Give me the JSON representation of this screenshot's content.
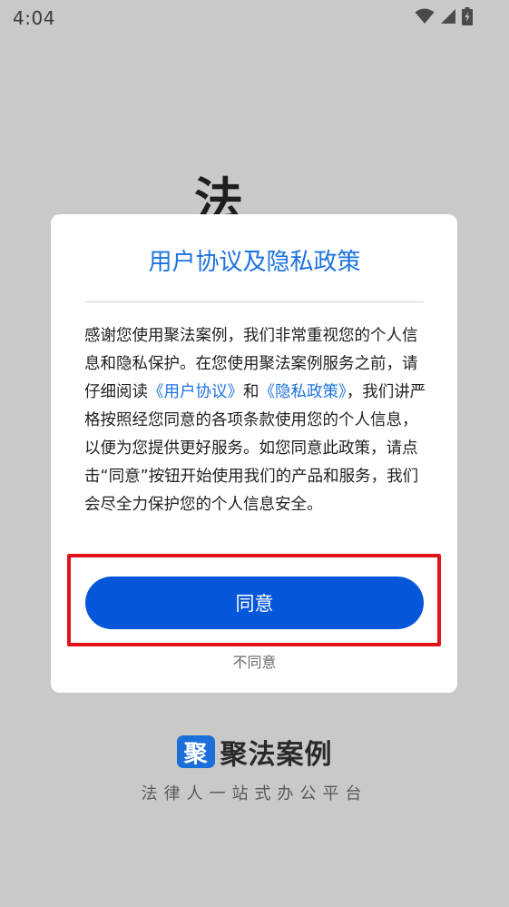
{
  "status_bar": {
    "time": "4:04",
    "icons": [
      "wifi-icon",
      "signal-icon",
      "battery-charging-icon"
    ]
  },
  "splash": {
    "partial_char": "法",
    "brand_logo_char": "聚",
    "brand_name": "聚法案例",
    "slogan": "法律人一站式办公平台"
  },
  "dialog": {
    "title": "用户协议及隐私政策",
    "body_part1": "感谢您使用聚法案例，我们非常重视您的个人信息和隐私保护。在您使用聚法案例服务之前，请仔细阅读",
    "link_user_agreement": "《用户协议》",
    "body_and": "和",
    "link_privacy_policy": "《隐私政策》",
    "body_part2": "，我们讲严格按照经您同意的各项条款使用您的个人信息，以便为您提供更好服务。如您同意此政策，请点击“同意”按钮开始使用我们的产品和服务，我们会尽全力保护您的个人信息安全。",
    "agree_label": "同意",
    "disagree_label": "不同意"
  },
  "colors": {
    "accent": "#1d73e0",
    "button": "#0656d9",
    "highlight_border": "#e1141b",
    "overlay_bg": "#c9c9c9"
  }
}
